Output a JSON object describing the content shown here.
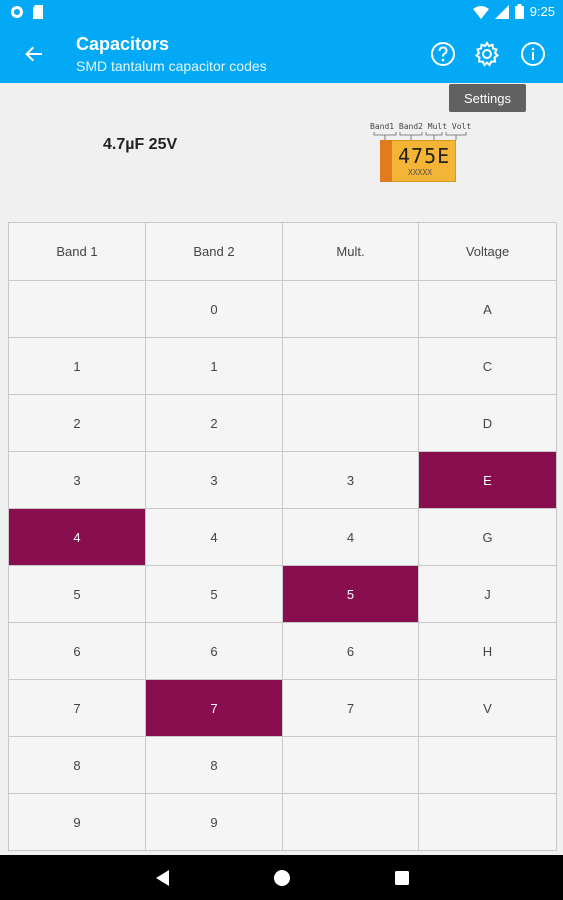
{
  "status_bar": {
    "time": "9:25"
  },
  "app_bar": {
    "title": "Capacitors",
    "subtitle": "SMD tantalum capacitor codes"
  },
  "tooltip": {
    "text": "Settings"
  },
  "result": {
    "value": "4.7µF 25V"
  },
  "capacitor": {
    "labels": "Band1 Band2 Mult Volt",
    "code": "475E",
    "sub": "XXXXX",
    "stripe_color": "#E07B1E",
    "body_color": "#F4B435"
  },
  "table": {
    "headers": [
      "Band 1",
      "Band 2",
      "Mult.",
      "Voltage"
    ],
    "rows": [
      [
        "",
        "0",
        "",
        "A"
      ],
      [
        "1",
        "1",
        "",
        "C"
      ],
      [
        "2",
        "2",
        "",
        "D"
      ],
      [
        "3",
        "3",
        "3",
        "E"
      ],
      [
        "4",
        "4",
        "4",
        "G"
      ],
      [
        "5",
        "5",
        "5",
        "J"
      ],
      [
        "6",
        "6",
        "6",
        "H"
      ],
      [
        "7",
        "7",
        "7",
        "V"
      ],
      [
        "8",
        "8",
        "",
        ""
      ],
      [
        "9",
        "9",
        "",
        ""
      ]
    ],
    "selected": {
      "band1": "4",
      "band2": "7",
      "mult": "5",
      "voltage": "E"
    },
    "selected_color": "#880E4F"
  },
  "colors": {
    "accent": "#03A9F4"
  },
  "icons": {
    "back": "arrow-back-icon",
    "help": "help-circle-icon",
    "settings": "gear-icon",
    "info": "info-circle-icon"
  }
}
